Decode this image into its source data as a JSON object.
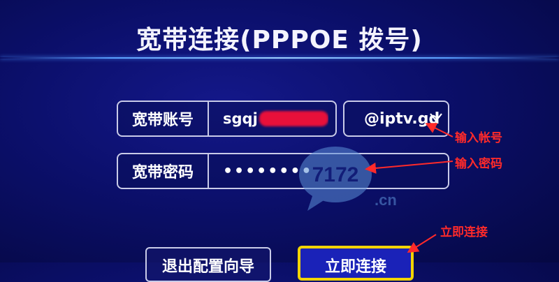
{
  "screen": {
    "title": "宽带连接(PPPOE 拨号)"
  },
  "account": {
    "label": "宽带账号",
    "value": "sgqj"
  },
  "domain": {
    "value": "@iptv.gd",
    "icon": "chevron-down-icon"
  },
  "password": {
    "label": "宽带密码",
    "value": "••••••••"
  },
  "buttons": {
    "exit": "退出配置向导",
    "connect": "立即连接"
  },
  "annotations": {
    "account": "输入帐号",
    "password": "输入密码",
    "connect": "立即连接"
  },
  "watermark": {
    "logo_text": "7172",
    "domain_text": ".cn"
  },
  "colors": {
    "annotation": "#ff2a2a",
    "focus_border": "#f2d400",
    "background": "#0b0f6a"
  }
}
